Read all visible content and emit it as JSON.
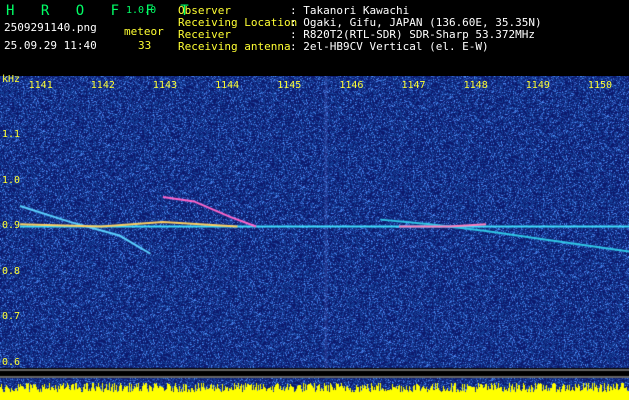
{
  "app": {
    "logo": "H R O F F T",
    "version": "1.0.0",
    "filename": "2509291140.png",
    "timestamp": "25.09.29 11:40",
    "meteor_label": "meteor",
    "meteor_count": "33"
  },
  "info": {
    "labels": [
      "Observer",
      "Receiving Location",
      "Receiver",
      "Receiving antenna"
    ],
    "values": [
      ": Takanori Kawachi",
      ": Ogaki, Gifu, JAPAN (136.60E, 35.35N)",
      ": R820T2(RTL-SDR) SDR-Sharp 53.372MHz",
      ": 2el-HB9CV Vertical (el. E-W)"
    ]
  },
  "chart_data": {
    "type": "heatmap",
    "ylabel": "kHz",
    "x_ticks": [
      "1141",
      "1142",
      "1143",
      "1144",
      "1145",
      "1146",
      "1147",
      "1148",
      "1149",
      "1150"
    ],
    "y_ticks": [
      "1.1",
      "1.0",
      "0.9",
      "0.8",
      "0.7",
      "0.6"
    ],
    "ylim": [
      0.58,
      1.2
    ],
    "xlim": [
      1140.7,
      1150.5
    ],
    "carrier_khz": 0.9,
    "colors": {
      "background": "#0c1a6e",
      "noise": "#3f57c8",
      "carrier": "#40e0ff",
      "meteor": "#ff66cc",
      "power_bar": "#ffff00",
      "axis": "#ffff33"
    }
  }
}
